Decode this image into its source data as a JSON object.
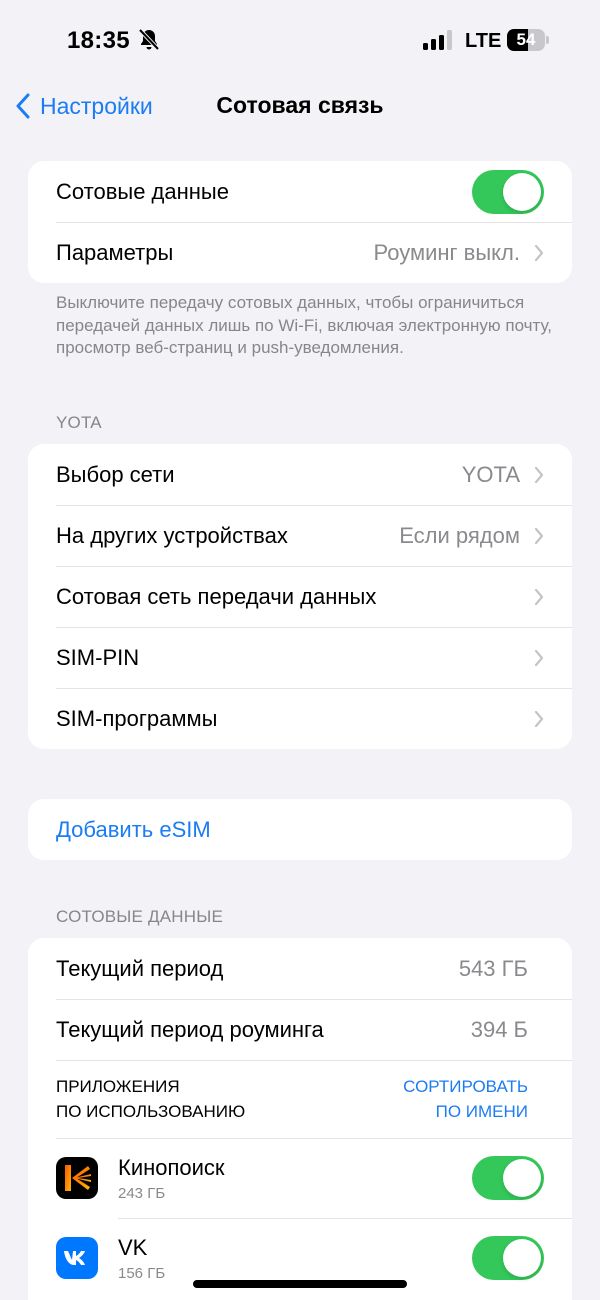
{
  "status_bar": {
    "time": "18:35",
    "network": "LTE",
    "battery": "54",
    "battery_level": 0.54
  },
  "nav": {
    "back_label": "Настройки",
    "title": "Сотовая связь"
  },
  "group1": {
    "cellular_data_label": "Сотовые данные",
    "cellular_data_on": true,
    "params_label": "Параметры",
    "params_value": "Роуминг выкл."
  },
  "footnote": "Выключите передачу сотовых данных, чтобы ограничиться передачей данных лишь по Wi-Fi, включая электронную почту, просмотр веб-страниц и push-уведомления.",
  "carrier_header": "YOTA",
  "carrier_rows": [
    {
      "label": "Выбор сети",
      "value": "YOTA"
    },
    {
      "label": "На других устройствах",
      "value": "Если рядом"
    },
    {
      "label": "Сотовая сеть передачи данных",
      "value": ""
    },
    {
      "label": "SIM-PIN",
      "value": ""
    },
    {
      "label": "SIM-программы",
      "value": ""
    }
  ],
  "add_esim": "Добавить eSIM",
  "usage_header": "СОТОВЫЕ ДАННЫЕ",
  "usage": {
    "current_label": "Текущий период",
    "current_value": "543 ГБ",
    "roaming_label": "Текущий период роуминга",
    "roaming_value": "394 Б",
    "apps_title_line1": "ПРИЛОЖЕНИЯ",
    "apps_title_line2": "ПО ИСПОЛЬЗОВАНИЮ",
    "sort_line1": "СОРТИРОВАТЬ",
    "sort_line2": "ПО ИМЕНИ"
  },
  "apps": [
    {
      "name": "Кинопоиск",
      "size": "243 ГБ",
      "enabled": true,
      "icon": "kinopoisk-icon"
    },
    {
      "name": "VK",
      "size": "156 ГБ",
      "enabled": true,
      "icon": "vk-icon"
    }
  ],
  "colors": {
    "accent": "#1c7cf4",
    "toggle_on": "#34c759",
    "background": "#f2f2f7",
    "secondary_text": "#8a8a8e"
  }
}
